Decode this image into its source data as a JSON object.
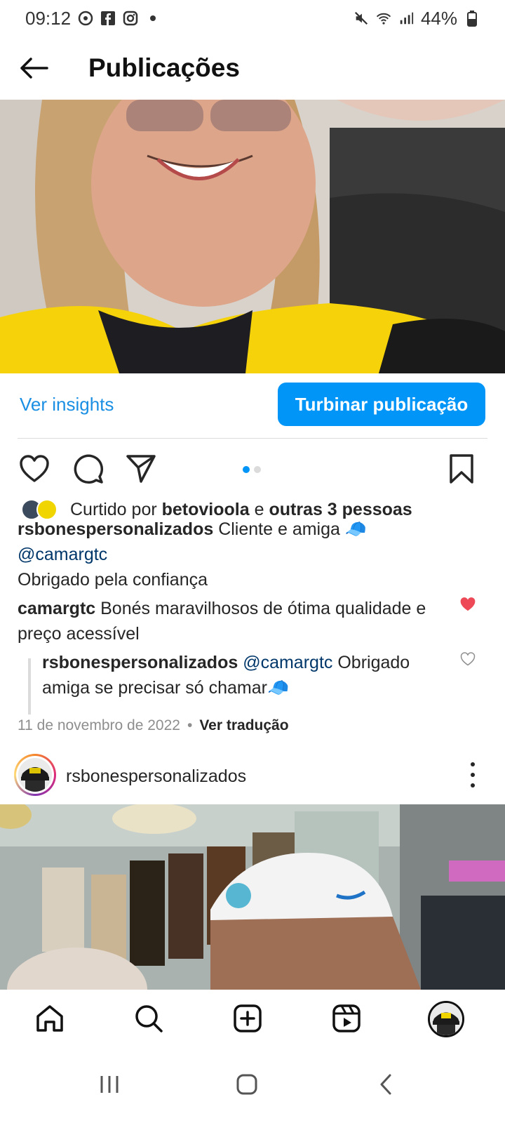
{
  "status_bar": {
    "time": "09:12",
    "battery": "44%"
  },
  "header": {
    "title": "Publicações"
  },
  "post1": {
    "insights_label": "Ver insights",
    "boost_label": "Turbinar publicação",
    "likes": {
      "prefix": "Curtido por",
      "liker": "betovioola",
      "connector": "e",
      "others": "outras 3 pessoas"
    },
    "caption": {
      "username": "rsbonespersonalizados",
      "text": "Cliente e amiga 🧢",
      "mention": "@camargtc",
      "line2": "Obrigado pela confiança"
    },
    "comment": {
      "username": "camargtc",
      "text": "Bonés maravilhosos de ótima qualidade e",
      "text2": "preço acessível"
    },
    "reply": {
      "username": "rsbonespersonalizados",
      "mention": "@camargtc",
      "text": "Obrigado",
      "text2": "amiga se precisar só chamar🧢"
    },
    "date": "11 de novembro de 2022",
    "translate_label": "Ver tradução"
  },
  "post2": {
    "username": "rsbonespersonalizados"
  },
  "colors": {
    "accent": "#0095f6",
    "link": "#1a8fe3",
    "mention": "#00376b",
    "liked_heart": "#ed4956"
  }
}
